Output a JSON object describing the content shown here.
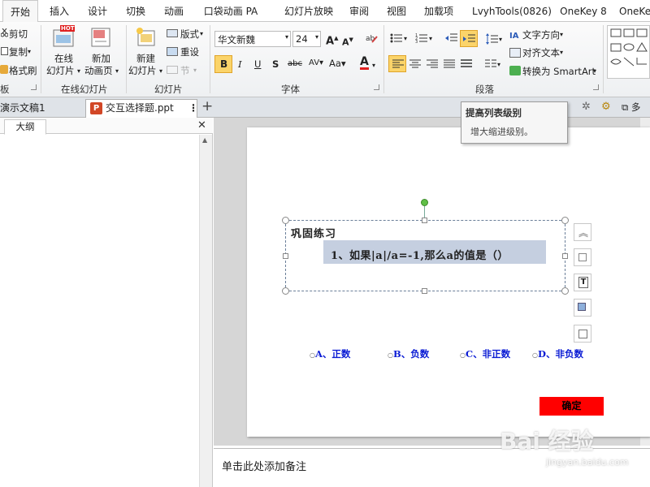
{
  "ribbon_tabs": [
    "开始",
    "插入",
    "设计",
    "切换",
    "动画",
    "口袋动画 PA",
    "幻灯片放映",
    "审阅",
    "视图",
    "加载项",
    "LvyhTools(0826)",
    "OneKey 8",
    "OneKe"
  ],
  "clipboard": {
    "cut": "剪切",
    "copy": "复制",
    "format_painter": "格式刷",
    "group": "板"
  },
  "online_slides": {
    "online_slide": "在线",
    "online_slide2": "幻灯片",
    "hot": "HOT",
    "new_page": "新加",
    "new_page2": "动画页",
    "group": "在线幻灯片"
  },
  "slides": {
    "new_slide": "新建",
    "new_slide2": "幻灯片",
    "layout": "版式",
    "reset": "重设",
    "section": "节",
    "group": "幻灯片"
  },
  "font": {
    "name": "华文新魏",
    "size": "24",
    "group": "字体"
  },
  "paragraph": {
    "text_direction": "文字方向",
    "align_text": "对齐文本",
    "convert_smartart": "转换为 SmartArt",
    "group": "段落"
  },
  "doc_tabs": {
    "tab1": "演示文稿1",
    "tab2": "交互选择题.ppt",
    "add": "+"
  },
  "left_panel": {
    "outline_tab": "大纲",
    "close": "✕"
  },
  "tooltip": {
    "title": "提高列表级别",
    "desc": "增大缩进级别。"
  },
  "slide": {
    "title": "巩固练习",
    "question": "1、如果|a|/a=-1,那么a的值是（）",
    "options": [
      "A、正数",
      "B、负数",
      "C、非正数",
      "D、非负数"
    ],
    "confirm": "确定"
  },
  "notes": {
    "placeholder": "单击此处添加备注"
  },
  "watermark": {
    "text": "Bai 经验",
    "url": "jingyan.baidu.com"
  },
  "colors": {
    "accent_orange": "#f5c542",
    "slide_blue": "#0a1bd4",
    "confirm_red": "#ff0000",
    "selection": "#c5cfe0"
  }
}
